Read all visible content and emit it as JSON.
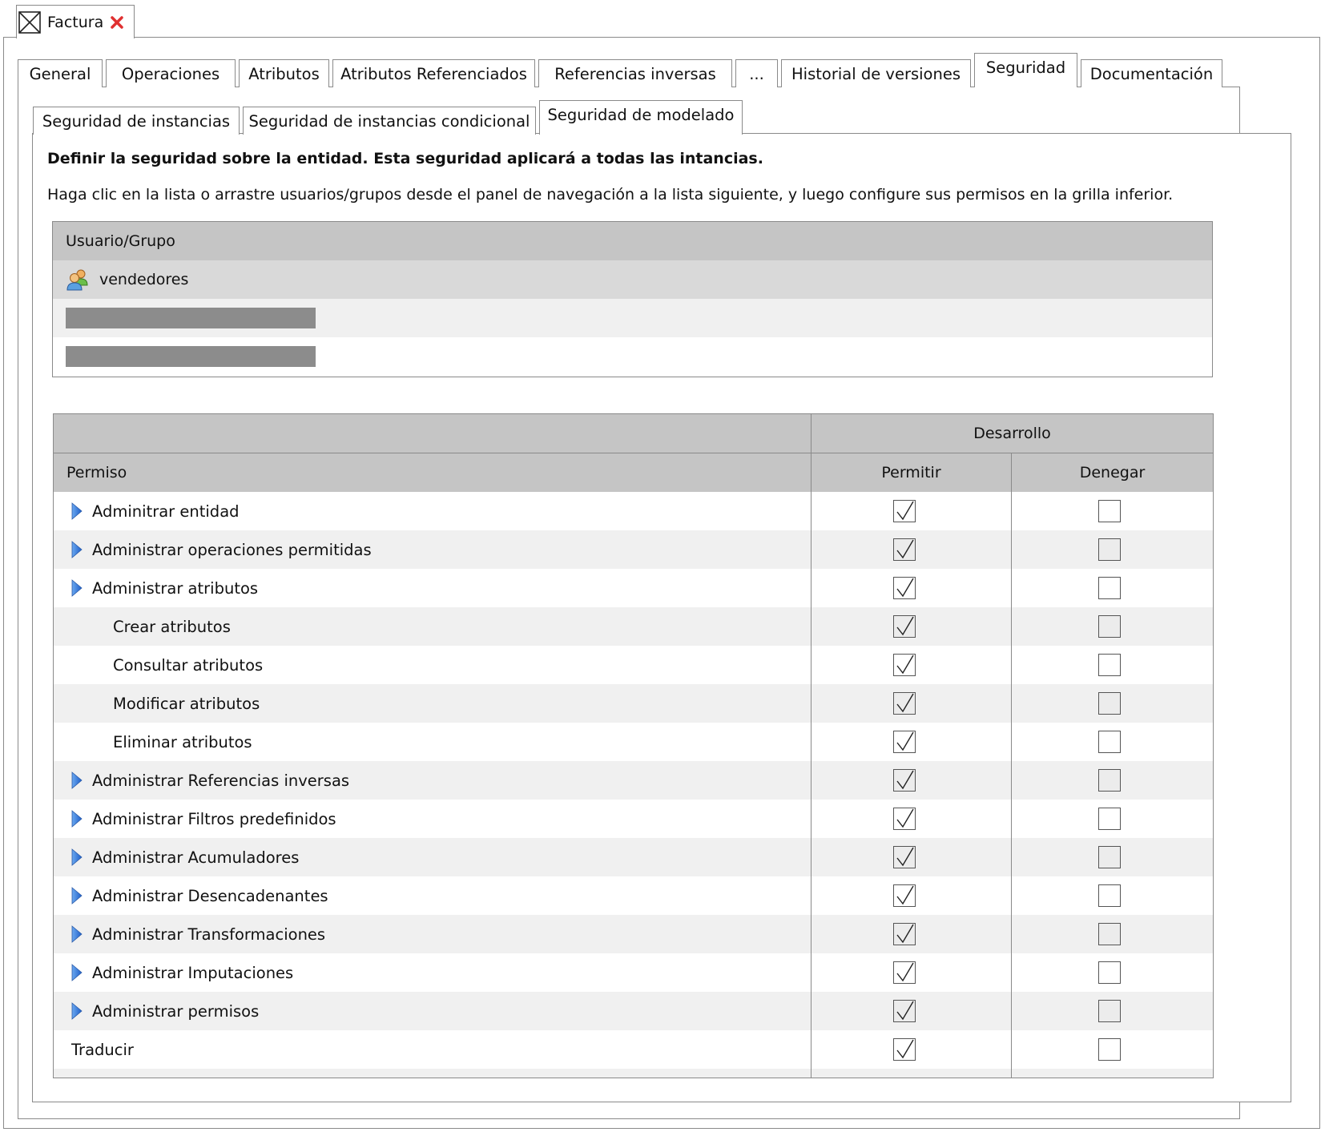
{
  "document": {
    "title": "Factura",
    "icon": "entity-icon",
    "close_icon": "close-icon"
  },
  "tabs": [
    {
      "label": "General",
      "active": false
    },
    {
      "label": "Operaciones",
      "active": false
    },
    {
      "label": "Atributos",
      "active": false
    },
    {
      "label": "Atributos Referenciados",
      "active": false
    },
    {
      "label": "Referencias inversas",
      "active": false
    },
    {
      "label": "...",
      "active": false
    },
    {
      "label": "Historial de versiones",
      "active": false
    },
    {
      "label": "Seguridad",
      "active": true
    },
    {
      "label": "Documentación",
      "active": false
    }
  ],
  "subtabs": [
    {
      "label": "Seguridad de instancias",
      "active": false
    },
    {
      "label": "Seguridad de instancias condicional",
      "active": false
    },
    {
      "label": "Seguridad de modelado",
      "active": true
    }
  ],
  "heading": "Definir la seguridad sobre la entidad. Esta seguridad aplicará a todas las intancias.",
  "instructions": "Haga clic en la lista o arrastre usuarios/grupos desde el panel de navegación a la lista siguiente, y luego configure sus permisos en la grilla inferior.",
  "users_grid": {
    "header": "Usuario/Grupo",
    "rows": [
      {
        "label": "vendedores",
        "icon": "group-icon",
        "selected": true
      },
      {
        "label": "",
        "redacted": true
      },
      {
        "label": "",
        "redacted": true
      }
    ]
  },
  "permissions_grid": {
    "group_header": "Desarrollo",
    "columns": {
      "name": "Permiso",
      "allow": "Permitir",
      "deny": "Denegar"
    },
    "rows": [
      {
        "label": "Adminitrar entidad",
        "expandable": true,
        "indent": false,
        "allow": true,
        "deny": false
      },
      {
        "label": "Administrar operaciones permitidas",
        "expandable": true,
        "indent": false,
        "allow": true,
        "deny": false
      },
      {
        "label": "Administrar atributos",
        "expandable": true,
        "indent": false,
        "allow": true,
        "deny": false
      },
      {
        "label": "Crear atributos",
        "expandable": false,
        "indent": true,
        "allow": true,
        "deny": false
      },
      {
        "label": "Consultar atributos",
        "expandable": false,
        "indent": true,
        "allow": true,
        "deny": false
      },
      {
        "label": "Modificar atributos",
        "expandable": false,
        "indent": true,
        "allow": true,
        "deny": false
      },
      {
        "label": "Eliminar atributos",
        "expandable": false,
        "indent": true,
        "allow": true,
        "deny": false
      },
      {
        "label": "Administrar Referencias inversas",
        "expandable": true,
        "indent": false,
        "allow": true,
        "deny": false
      },
      {
        "label": "Administrar Filtros predefinidos",
        "expandable": true,
        "indent": false,
        "allow": true,
        "deny": false
      },
      {
        "label": "Administrar Acumuladores",
        "expandable": true,
        "indent": false,
        "allow": true,
        "deny": false
      },
      {
        "label": "Administrar Desencadenantes",
        "expandable": true,
        "indent": false,
        "allow": true,
        "deny": false
      },
      {
        "label": "Administrar Transformaciones",
        "expandable": true,
        "indent": false,
        "allow": true,
        "deny": false
      },
      {
        "label": "Administrar Imputaciones",
        "expandable": true,
        "indent": false,
        "allow": true,
        "deny": false
      },
      {
        "label": "Administrar permisos",
        "expandable": true,
        "indent": false,
        "allow": true,
        "deny": false
      },
      {
        "label": "Traducir",
        "expandable": false,
        "indent": false,
        "allow": true,
        "deny": false
      }
    ]
  },
  "colors": {
    "header_bg": "#c5c5c5",
    "alt_row_bg": "#f0f0f0",
    "selected_row_bg": "#d9d9d9",
    "expand_arrow": "#3a78d8",
    "close_x": "#e03030",
    "border": "#8a8a8a"
  }
}
